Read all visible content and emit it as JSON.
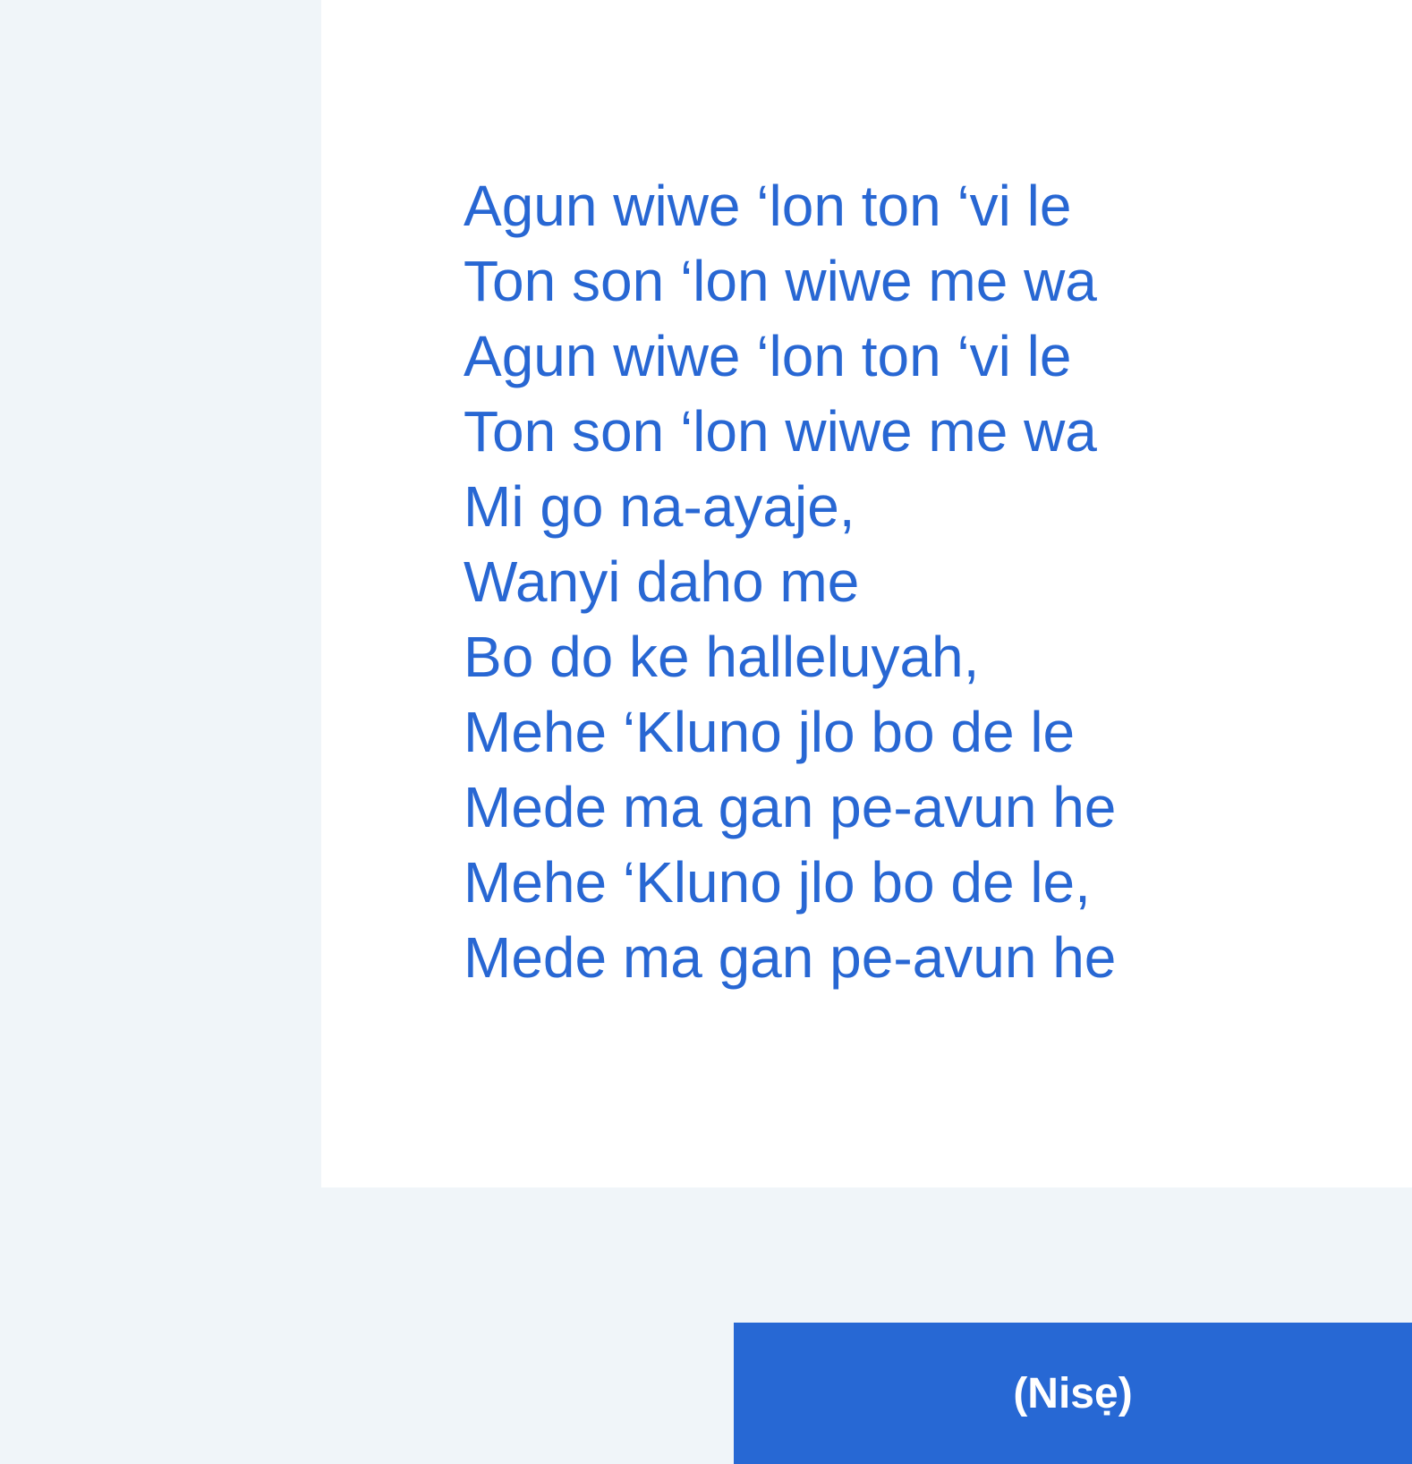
{
  "lyrics": {
    "lines": [
      "Agun wiwe ‘lon ton ‘vi le",
      "Ton son ‘lon wiwe me wa",
      "Agun wiwe ‘lon ton ‘vi le",
      "Ton son ‘lon wiwe me wa",
      "Mi go na-ayaje,",
      "Wanyi daho me",
      "Bo do ke halleluyah,",
      "Mehe ‘Kluno jlo bo de le",
      "Mede ma gan pe-avun he",
      "Mehe ‘Kluno jlo bo de le,",
      "Mede ma gan pe-avun he"
    ]
  },
  "navigation": {
    "next_label": "(Nisẹ)"
  },
  "colors": {
    "page_background": "#f0f5f9",
    "card_background": "#ffffff",
    "lyric_text": "#2867d3",
    "button_background": "#2768d4",
    "button_text": "#ffffff"
  }
}
